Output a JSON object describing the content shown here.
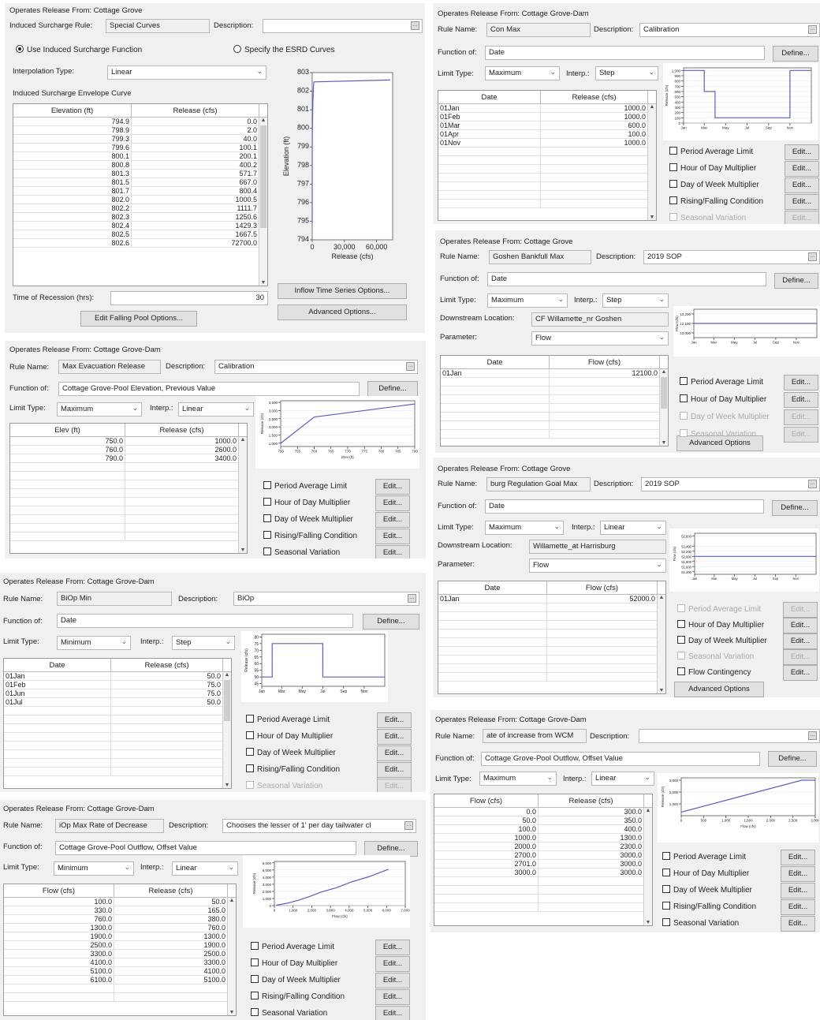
{
  "p1": {
    "title": "Operates Release From: Cottage Grove",
    "isr_label": "Induced Surcharge Rule:",
    "isr_value": "Special Curves",
    "desc_label": "Description:",
    "desc_value": "",
    "radio1": "Use Induced Surcharge Function",
    "radio2": "Specify the ESRD Curves",
    "interp_label": "Interpolation Type:",
    "interp_value": "Linear",
    "env_label": "Induced Surcharge Envelope Curve",
    "col1": "Elevation (ft)",
    "col2": "Release (cfs)",
    "rows": [
      [
        "794.9",
        "0.0"
      ],
      [
        "798.9",
        "2.0"
      ],
      [
        "799.3",
        "40.0"
      ],
      [
        "799.6",
        "100.1"
      ],
      [
        "800.1",
        "200.1"
      ],
      [
        "800.8",
        "400.2"
      ],
      [
        "801.3",
        "571.7"
      ],
      [
        "801.5",
        "667.0"
      ],
      [
        "801.7",
        "800.4"
      ],
      [
        "802.0",
        "1000.5"
      ],
      [
        "802.2",
        "1111.7"
      ],
      [
        "802.3",
        "1250.6"
      ],
      [
        "802.4",
        "1429.3"
      ],
      [
        "802.5",
        "1667.5"
      ],
      [
        "802.6",
        "72700.0"
      ]
    ],
    "recession_label": "Time of Recession (hrs):",
    "recession_value": "30",
    "edit_falling": "Edit Falling Pool Options...",
    "inflow_btn": "Inflow Time Series Options...",
    "advanced_btn": "Advanced Options...",
    "chart": {
      "ylabel": "Elevation (ft)",
      "xlabel": "Release (cfs)",
      "yticks": [
        "803",
        "802",
        "801",
        "800",
        "799",
        "798",
        "797",
        "796",
        "795",
        "794"
      ],
      "xticks": [
        "0",
        "30,000",
        "60,000"
      ]
    }
  },
  "p2": {
    "title": "Operates Release From: Cottage Grove-Dam",
    "rule_label": "Rule Name:",
    "rule_value": "Con Max",
    "desc_label": "Description:",
    "desc_value": "Calibration",
    "func_label": "Function of:",
    "func_value": "Date",
    "define": "Define...",
    "limit_label": "Limit Type:",
    "limit_value": "Maximum",
    "interp_label": "Interp.:",
    "interp_value": "Step",
    "col1": "Date",
    "col2": "Release (cfs)",
    "rows": [
      [
        "01Jan",
        "1000.0"
      ],
      [
        "01Feb",
        "1000.0"
      ],
      [
        "01Mar",
        "600.0"
      ],
      [
        "01Apr",
        "100.0"
      ],
      [
        "01Nov",
        "1000.0"
      ]
    ],
    "opts": [
      "Period Average Limit",
      "Hour of Day Multiplier",
      "Day of Week Multiplier",
      "Rising/Falling Condition",
      "Seasonal Variation"
    ],
    "edit": "Edit...",
    "chart": {
      "yticks": [
        "1,000",
        "900",
        "800",
        "700",
        "600",
        "500",
        "400",
        "300",
        "200",
        "100",
        "0"
      ],
      "xticks": [
        "Jan",
        "Mar",
        "May",
        "Jul",
        "Sep",
        "Nov"
      ],
      "ylabel": "Release (cfs)"
    }
  },
  "p3": {
    "title": "Operates Release From: Cottage Grove",
    "rule_label": "Rule Name:",
    "rule_value": "Goshen Bankfull Max",
    "desc_label": "Description:",
    "desc_value": "2019 SOP",
    "func_label": "Function of:",
    "func_value": "Date",
    "define": "Define...",
    "limit_label": "Limit Type:",
    "limit_value": "Maximum",
    "interp_label": "Interp.:",
    "interp_value": "Step",
    "down_label": "Downstream Location:",
    "down_value": "CF Willamette_nr Goshen",
    "param_label": "Parameter:",
    "param_value": "Flow",
    "col1": "Date",
    "col2": "Flow (cfs)",
    "rows": [
      [
        "01Jan",
        "12100.0"
      ]
    ],
    "opts": [
      "Period Average Limit",
      "Hour of Day Multiplier",
      "Day of Week Multiplier",
      "Seasonal Variation"
    ],
    "edit": "Edit...",
    "advanced": "Advanced Options",
    "chart": {
      "yticks": [
        "12,200",
        "12,100",
        "12,000"
      ],
      "xticks": [
        "Jan",
        "Mar",
        "May",
        "Jul",
        "Sep",
        "Nov"
      ],
      "ylabel": "Flow (cfs)"
    }
  },
  "p4": {
    "title": "Operates Release From: Cottage Grove-Dam",
    "rule_label": "Rule Name:",
    "rule_value": "Max Evacuation Release",
    "desc_label": "Description:",
    "desc_value": "Calibration",
    "func_label": "Function of:",
    "func_value": "Cottage Grove-Pool Elevation, Previous Value",
    "define": "Define...",
    "limit_label": "Limit Type:",
    "limit_value": "Maximum",
    "interp_label": "Interp.:",
    "interp_value": "Linear",
    "col1": "Elev (ft)",
    "col2": "Release (cfs)",
    "rows": [
      [
        "750.0",
        "1000.0"
      ],
      [
        "760.0",
        "2600.0"
      ],
      [
        "790.0",
        "3400.0"
      ]
    ],
    "opts": [
      "Period Average Limit",
      "Hour of Day Multiplier",
      "Day of Week Multiplier",
      "Rising/Falling Condition",
      "Seasonal Variation"
    ],
    "edit": "Edit...",
    "chart": {
      "yticks": [
        "3,500",
        "3,000",
        "2,500",
        "2,000",
        "1,500",
        "1,000"
      ],
      "xticks": [
        "750",
        "755",
        "760",
        "765",
        "770",
        "775",
        "780",
        "785",
        "790"
      ],
      "ylabel": "Release (cfs)",
      "xlabel": "Elev (ft)"
    }
  },
  "p5": {
    "title": "Operates Release From: Cottage Grove",
    "rule_label": "Rule Name:",
    "rule_value": "burg Regulation Goal Max",
    "desc_label": "Description:",
    "desc_value": "2019 SOP",
    "func_label": "Function of:",
    "func_value": "Date",
    "define": "Define...",
    "limit_label": "Limit Type:",
    "limit_value": "Maximum",
    "interp_label": "Interp.:",
    "interp_value": "Linear",
    "down_label": "Downstream Location:",
    "down_value": "Willamette_at Harrisburg",
    "param_label": "Parameter:",
    "param_value": "Flow",
    "col1": "Date",
    "col2": "Flow (cfs)",
    "rows": [
      [
        "01Jan",
        "52000.0"
      ]
    ],
    "opts": [
      "Period Average Limit",
      "Hour of Day Multiplier",
      "Day of Week Multiplier",
      "Seasonal Variation",
      "Flow Contingency"
    ],
    "edit": "Edit...",
    "advanced": "Advanced Options",
    "chart": {
      "yticks": [
        "52,800",
        "52,400",
        "52,200",
        "52,000",
        "51,800",
        "51,600",
        "51,400"
      ],
      "xticks": [
        "Jan",
        "Mar",
        "May",
        "Jul",
        "Sep",
        "Nov"
      ],
      "ylabel": "Flow (cfs)"
    }
  },
  "p6": {
    "title": "Operates Release From: Cottage Grove-Dam",
    "rule_label": "Rule Name:",
    "rule_value": "BiOp Min",
    "desc_label": "Description:",
    "desc_value": "BiOp",
    "func_label": "Function of:",
    "func_value": "Date",
    "define": "Define...",
    "limit_label": "Limit Type:",
    "limit_value": "Minimum",
    "interp_label": "Interp.:",
    "interp_value": "Step",
    "col1": "Date",
    "col2": "Release (cfs)",
    "rows": [
      [
        "01Jan",
        "50.0"
      ],
      [
        "01Feb",
        "75.0"
      ],
      [
        "01Jun",
        "75.0"
      ],
      [
        "01Jul",
        "50.0"
      ]
    ],
    "opts": [
      "Period Average Limit",
      "Hour of Day Multiplier",
      "Day of Week Multiplier",
      "Rising/Falling Condition",
      "Seasonal Variation"
    ],
    "edit": "Edit...",
    "chart": {
      "yticks": [
        "80",
        "75",
        "70",
        "65",
        "60",
        "55",
        "50",
        "45"
      ],
      "xticks": [
        "Jan",
        "Mar",
        "May",
        "Jul",
        "Sep",
        "Nov"
      ],
      "ylabel": "Release (cfs)"
    }
  },
  "p7": {
    "title": "Operates Release From: Cottage Grove-Dam",
    "rule_label": "Rule Name:",
    "rule_value": "ate of increase from WCM",
    "desc_label": "Description:",
    "desc_value": "",
    "func_label": "Function of:",
    "func_value": "Cottage Grove-Pool Outflow, Offset Value",
    "define": "Define...",
    "limit_label": "Limit Type:",
    "limit_value": "Maximum",
    "interp_label": "Interp.:",
    "interp_value": "Linear",
    "col1": "Flow (cfs)",
    "col2": "Release (cfs)",
    "rows": [
      [
        "0.0",
        "300.0"
      ],
      [
        "50.0",
        "350.0"
      ],
      [
        "100.0",
        "400.0"
      ],
      [
        "1000.0",
        "1300.0"
      ],
      [
        "2000.0",
        "2300.0"
      ],
      [
        "2700.0",
        "3000.0"
      ],
      [
        "2701.0",
        "3000.0"
      ],
      [
        "3000.0",
        "3000.0"
      ]
    ],
    "opts": [
      "Period Average Limit",
      "Hour of Day Multiplier",
      "Day of Week Multiplier",
      "Rising/Falling Condition",
      "Seasonal Variation"
    ],
    "edit": "Edit...",
    "chart": {
      "yticks": [
        "3,000",
        "2,000",
        "1,000"
      ],
      "xticks": [
        "0",
        "500",
        "1,000",
        "1,500",
        "2,000",
        "2,500",
        "3,000"
      ],
      "ylabel": "Release (cfs)",
      "xlabel": "Flow (cfs)"
    }
  },
  "p8": {
    "title": "Operates Release From: Cottage Grove-Dam",
    "rule_label": "Rule Name:",
    "rule_value": "iOp Max Rate of Decrease",
    "desc_label": "Description:",
    "desc_value": "Chooses the lesser of 1' per day tailwater cl",
    "func_label": "Function of:",
    "func_value": "Cottage Grove-Pool Outflow, Offset Value",
    "define": "Define...",
    "limit_label": "Limit Type:",
    "limit_value": "Minimum",
    "interp_label": "Interp.:",
    "interp_value": "Linear",
    "col1": "Flow (cfs)",
    "col2": "Release (cfs)",
    "rows": [
      [
        "100.0",
        "50.0"
      ],
      [
        "330.0",
        "165.0"
      ],
      [
        "760.0",
        "380.0"
      ],
      [
        "1300.0",
        "760.0"
      ],
      [
        "1900.0",
        "1300.0"
      ],
      [
        "2500.0",
        "1900.0"
      ],
      [
        "3300.0",
        "2500.0"
      ],
      [
        "4100.0",
        "3300.0"
      ],
      [
        "5100.0",
        "4100.0"
      ],
      [
        "6100.0",
        "5100.0"
      ]
    ],
    "opts": [
      "Period Average Limit",
      "Hour of Day Multiplier",
      "Day of Week Multiplier",
      "Rising/Falling Condition",
      "Seasonal Variation"
    ],
    "edit": "Edit...",
    "chart": {
      "yticks": [
        "6,000",
        "5,000",
        "4,000",
        "3,000",
        "2,000",
        "1,000",
        "0"
      ],
      "xticks": [
        "0",
        "1,000",
        "2,000",
        "3,000",
        "4,000",
        "5,000",
        "6,000",
        "7,000"
      ],
      "ylabel": "Release (cfs)",
      "xlabel": "Flow (cfs)"
    }
  },
  "colors": {
    "panel_bg": "#f0f0f0",
    "line": "#5b5bd6",
    "button": "#e1e1e1"
  }
}
